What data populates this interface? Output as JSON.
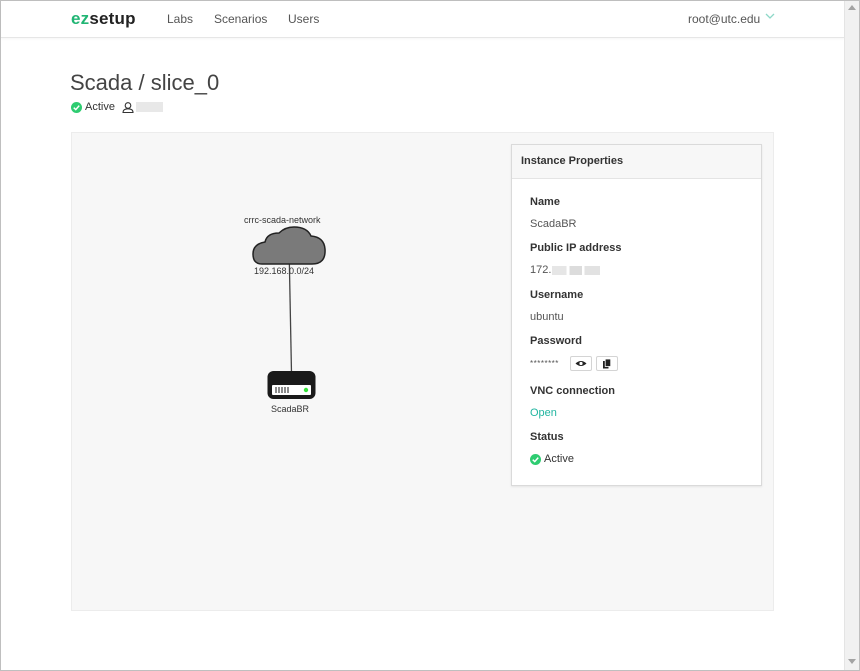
{
  "nav": {
    "brand_ez": "ez",
    "brand_setup": "setup",
    "links": [
      "Labs",
      "Scenarios",
      "Users"
    ],
    "user": "root@utc.edu"
  },
  "page": {
    "title": "Scada / slice_0",
    "status": "Active"
  },
  "topology": {
    "network_name": "crrc-scada-network",
    "network_cidr": "192.168.0.0/24",
    "instance_name": "ScadaBR"
  },
  "panel": {
    "title": "Instance Properties",
    "name_label": "Name",
    "name_value": "ScadaBR",
    "ip_label": "Public IP address",
    "ip_prefix": "172.",
    "username_label": "Username",
    "username_value": "ubuntu",
    "password_label": "Password",
    "password_masked": "********",
    "vnc_label": "VNC connection",
    "vnc_link": "Open",
    "status_label": "Status",
    "status_value": "Active"
  },
  "colors": {
    "accent": "#21b574",
    "link": "#21b5a0",
    "canvas_bg": "#f7f7f7",
    "status_active": "#2ecc71"
  },
  "icons": [
    "chevron-down-icon",
    "check-circle-icon",
    "user-icon",
    "cloud-icon",
    "router-icon",
    "eye-icon",
    "copy-icon"
  ]
}
